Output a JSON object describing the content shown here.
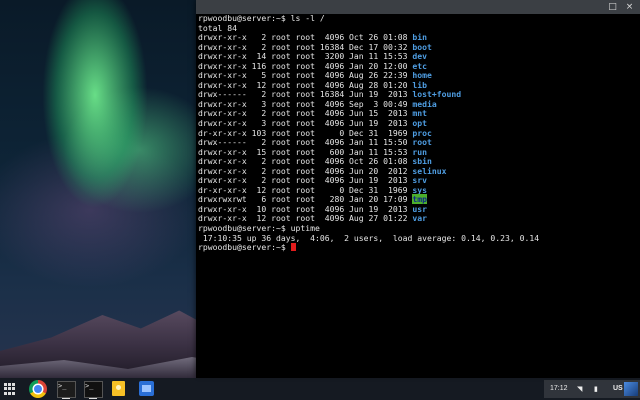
{
  "terminal": {
    "lines": [
      {
        "type": "prompt",
        "text": "rpwoodbu@server:~$ ls -l /"
      },
      {
        "type": "plain",
        "text": "total 84"
      },
      {
        "type": "entry",
        "perm": "drwxr-xr-x",
        "links": "2",
        "owner": "root",
        "group": "root",
        "size": "4096",
        "month": "Oct",
        "day": "26",
        "time": "01:08",
        "name": "bin"
      },
      {
        "type": "entry",
        "perm": "drwxr-xr-x",
        "links": "2",
        "owner": "root",
        "group": "root",
        "size": "16384",
        "month": "Dec",
        "day": "17",
        "time": "00:32",
        "name": "boot"
      },
      {
        "type": "entry",
        "perm": "drwxr-xr-x",
        "links": "14",
        "owner": "root",
        "group": "root",
        "size": "3200",
        "month": "Jan",
        "day": "11",
        "time": "15:53",
        "name": "dev"
      },
      {
        "type": "entry",
        "perm": "drwxr-xr-x",
        "links": "116",
        "owner": "root",
        "group": "root",
        "size": "4096",
        "month": "Jan",
        "day": "20",
        "time": "12:00",
        "name": "etc"
      },
      {
        "type": "entry",
        "perm": "drwxr-xr-x",
        "links": "5",
        "owner": "root",
        "group": "root",
        "size": "4096",
        "month": "Aug",
        "day": "26",
        "time": "22:39",
        "name": "home"
      },
      {
        "type": "entry",
        "perm": "drwxr-xr-x",
        "links": "12",
        "owner": "root",
        "group": "root",
        "size": "4096",
        "month": "Aug",
        "day": "28",
        "time": "01:20",
        "name": "lib"
      },
      {
        "type": "entry",
        "perm": "drwx------",
        "links": "2",
        "owner": "root",
        "group": "root",
        "size": "16384",
        "month": "Jun",
        "day": "19",
        "time": "2013",
        "name": "lost+found"
      },
      {
        "type": "entry",
        "perm": "drwxr-xr-x",
        "links": "3",
        "owner": "root",
        "group": "root",
        "size": "4096",
        "month": "Sep",
        "day": "3",
        "time": "00:49",
        "name": "media"
      },
      {
        "type": "entry",
        "perm": "drwxr-xr-x",
        "links": "2",
        "owner": "root",
        "group": "root",
        "size": "4096",
        "month": "Jun",
        "day": "15",
        "time": "2013",
        "name": "mnt"
      },
      {
        "type": "entry",
        "perm": "drwxr-xr-x",
        "links": "3",
        "owner": "root",
        "group": "root",
        "size": "4096",
        "month": "Jun",
        "day": "19",
        "time": "2013",
        "name": "opt"
      },
      {
        "type": "entry",
        "perm": "dr-xr-xr-x",
        "links": "103",
        "owner": "root",
        "group": "root",
        "size": "0",
        "month": "Dec",
        "day": "31",
        "time": "1969",
        "name": "proc"
      },
      {
        "type": "entry",
        "perm": "drwx------",
        "links": "2",
        "owner": "root",
        "group": "root",
        "size": "4096",
        "month": "Jan",
        "day": "11",
        "time": "15:50",
        "name": "root"
      },
      {
        "type": "entry",
        "perm": "drwxr-xr-x",
        "links": "15",
        "owner": "root",
        "group": "root",
        "size": "600",
        "month": "Jan",
        "day": "11",
        "time": "15:53",
        "name": "run"
      },
      {
        "type": "entry",
        "perm": "drwxr-xr-x",
        "links": "2",
        "owner": "root",
        "group": "root",
        "size": "4096",
        "month": "Oct",
        "day": "26",
        "time": "01:08",
        "name": "sbin"
      },
      {
        "type": "entry",
        "perm": "drwxr-xr-x",
        "links": "2",
        "owner": "root",
        "group": "root",
        "size": "4096",
        "month": "Jun",
        "day": "20",
        "time": "2012",
        "name": "selinux"
      },
      {
        "type": "entry",
        "perm": "drwxr-xr-x",
        "links": "2",
        "owner": "root",
        "group": "root",
        "size": "4096",
        "month": "Jun",
        "day": "19",
        "time": "2013",
        "name": "srv"
      },
      {
        "type": "entry",
        "perm": "dr-xr-xr-x",
        "links": "12",
        "owner": "root",
        "group": "root",
        "size": "0",
        "month": "Dec",
        "day": "31",
        "time": "1969",
        "name": "sys"
      },
      {
        "type": "entry",
        "perm": "drwxrwxrwt",
        "links": "6",
        "owner": "root",
        "group": "root",
        "size": "280",
        "month": "Jan",
        "day": "20",
        "time": "17:09",
        "name": "tmp",
        "sticky": true
      },
      {
        "type": "entry",
        "perm": "drwxr-xr-x",
        "links": "10",
        "owner": "root",
        "group": "root",
        "size": "4096",
        "month": "Jun",
        "day": "19",
        "time": "2013",
        "name": "usr"
      },
      {
        "type": "entry",
        "perm": "drwxr-xr-x",
        "links": "12",
        "owner": "root",
        "group": "root",
        "size": "4096",
        "month": "Aug",
        "day": "27",
        "time": "01:22",
        "name": "var"
      },
      {
        "type": "prompt",
        "text": "rpwoodbu@server:~$ uptime"
      },
      {
        "type": "plain",
        "text": " 17:10:35 up 36 days,  4:06,  2 users,  load average: 0.14, 0.23, 0.14"
      },
      {
        "type": "cursor",
        "text": "rpwoodbu@server:~$ "
      }
    ]
  },
  "window": {
    "maximize_icon": "maximize-icon",
    "close_icon": "close-icon",
    "maximize_glyph": "□",
    "close_glyph": "×"
  },
  "shelf": {
    "apps": [
      "chrome",
      "terminal",
      "crosh",
      "keep",
      "files"
    ],
    "terminal_glyph": ">_",
    "tray": {
      "time": "17:12",
      "language": "US",
      "wifi_glyph": "◥",
      "battery_glyph": "▮"
    }
  },
  "colors": {
    "directory": "#4f9ee3",
    "sticky_bg": "#4caf2c",
    "cursor": "#e31c1c"
  }
}
